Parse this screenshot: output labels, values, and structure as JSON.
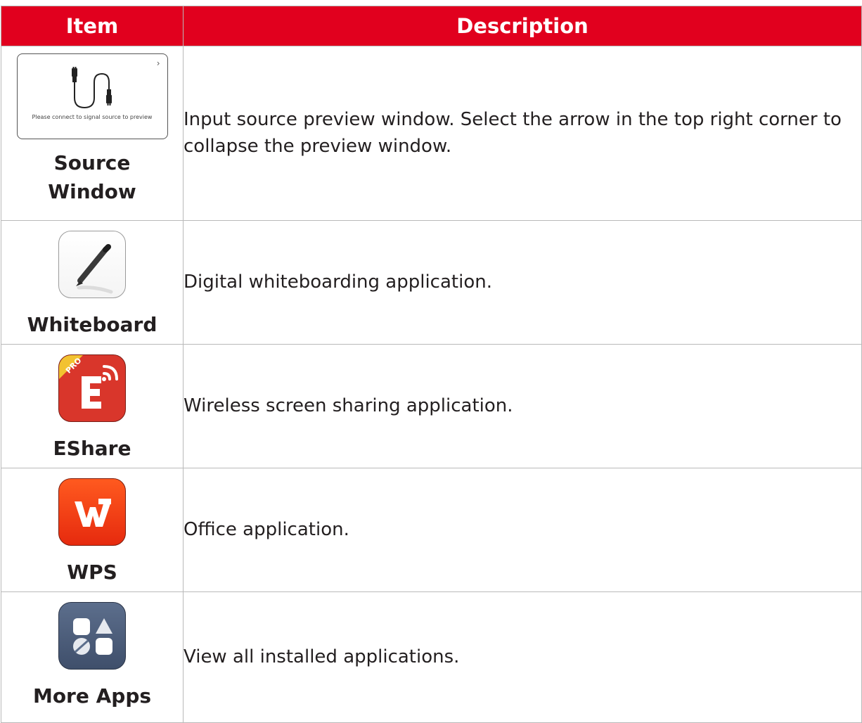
{
  "header": {
    "item": "Item",
    "description": "Description"
  },
  "rows": [
    {
      "icon": "source-window-preview",
      "preview_text": "Please connect to signal source to preview",
      "name_line1": "Source",
      "name_line2": "Window",
      "description": "Input source preview window. Select the arrow in the top right corner to collapse the preview window."
    },
    {
      "icon": "pen-icon",
      "name": "Whiteboard",
      "description": "Digital whiteboarding application."
    },
    {
      "icon": "eshare-icon",
      "badge": "PRO",
      "name": "EShare",
      "description": "Wireless screen sharing application."
    },
    {
      "icon": "wps-icon",
      "name": "WPS",
      "description": "Office application."
    },
    {
      "icon": "apps-grid-icon",
      "name": "More Apps",
      "description": "View all installed applications."
    }
  ],
  "colors": {
    "header_bg": "#e1001e",
    "header_text": "#ffffff",
    "body_text": "#231f20",
    "border": "#b9b9b9"
  }
}
